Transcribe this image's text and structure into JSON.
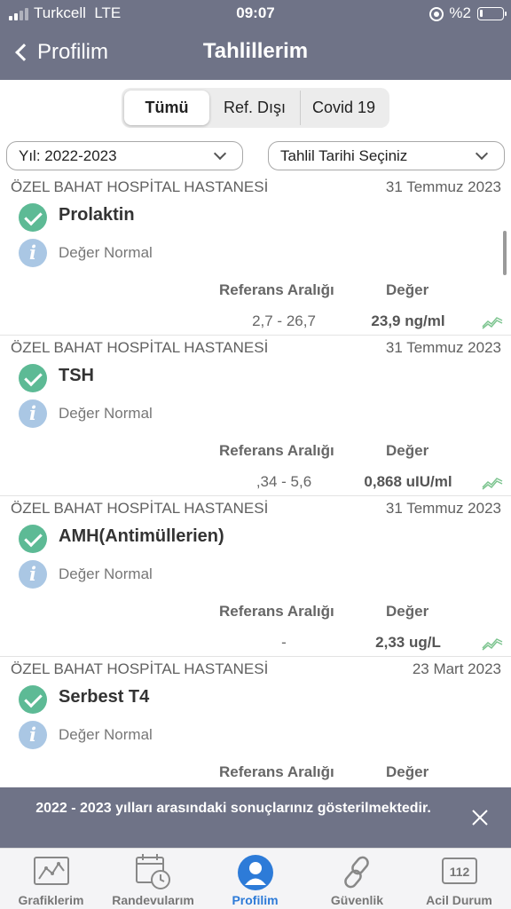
{
  "status_bar": {
    "carrier": "Turkcell",
    "network": "LTE",
    "time": "09:07",
    "battery": "%2"
  },
  "nav": {
    "back_label": "Profilim",
    "title": "Tahlillerim"
  },
  "segments": [
    "Tümü",
    "Ref. Dışı",
    "Covid 19"
  ],
  "selected_segment": "Tümü",
  "filters": {
    "year": "Yıl: 2022-2023",
    "date_placeholder": "Tahlil Tarihi Seçiniz"
  },
  "labels": {
    "reference": "Referans Aralığı",
    "value": "Değer"
  },
  "results": [
    {
      "hospital": "ÖZEL BAHAT HOSPİTAL HASTANESİ",
      "date": "31 Temmuz 2023",
      "test": "Prolaktin",
      "status": "Değer Normal",
      "reference": "2,7 - 26,7",
      "value": "23,9 ng/ml"
    },
    {
      "hospital": "ÖZEL BAHAT HOSPİTAL HASTANESİ",
      "date": "31 Temmuz 2023",
      "test": "TSH",
      "status": "Değer Normal",
      "reference": ",34 - 5,6",
      "value": "0,868 uIU/ml"
    },
    {
      "hospital": "ÖZEL BAHAT HOSPİTAL HASTANESİ",
      "date": "31 Temmuz 2023",
      "test": "AMH(Antimüllerien)",
      "status": "Değer Normal",
      "reference": "-",
      "value": "2,33 ug/L"
    },
    {
      "hospital": "ÖZEL BAHAT HOSPİTAL HASTANESİ",
      "date": "23 Mart 2023",
      "test": "Serbest T4",
      "status": "Değer Normal",
      "reference": "",
      "value": ""
    }
  ],
  "banner": {
    "message": "2022 - 2023 yılları arasındaki sonuçlarınız gösterilmektedir."
  },
  "tabbar": [
    {
      "label": "Grafiklerim",
      "icon": "chart-icon"
    },
    {
      "label": "Randevularım",
      "icon": "calendar-clock-icon"
    },
    {
      "label": "Profilim",
      "icon": "profile-icon"
    },
    {
      "label": "Güvenlik",
      "icon": "link-icon"
    },
    {
      "label": "Acil Durum",
      "icon": "emergency-112-icon",
      "badge": "112"
    }
  ],
  "active_tab": "Profilim",
  "colors": {
    "header": "#6f7387",
    "success": "#5dba95",
    "info": "#aac7e4",
    "active_tab": "#2d7bd8",
    "trend": "#7cc48f"
  }
}
